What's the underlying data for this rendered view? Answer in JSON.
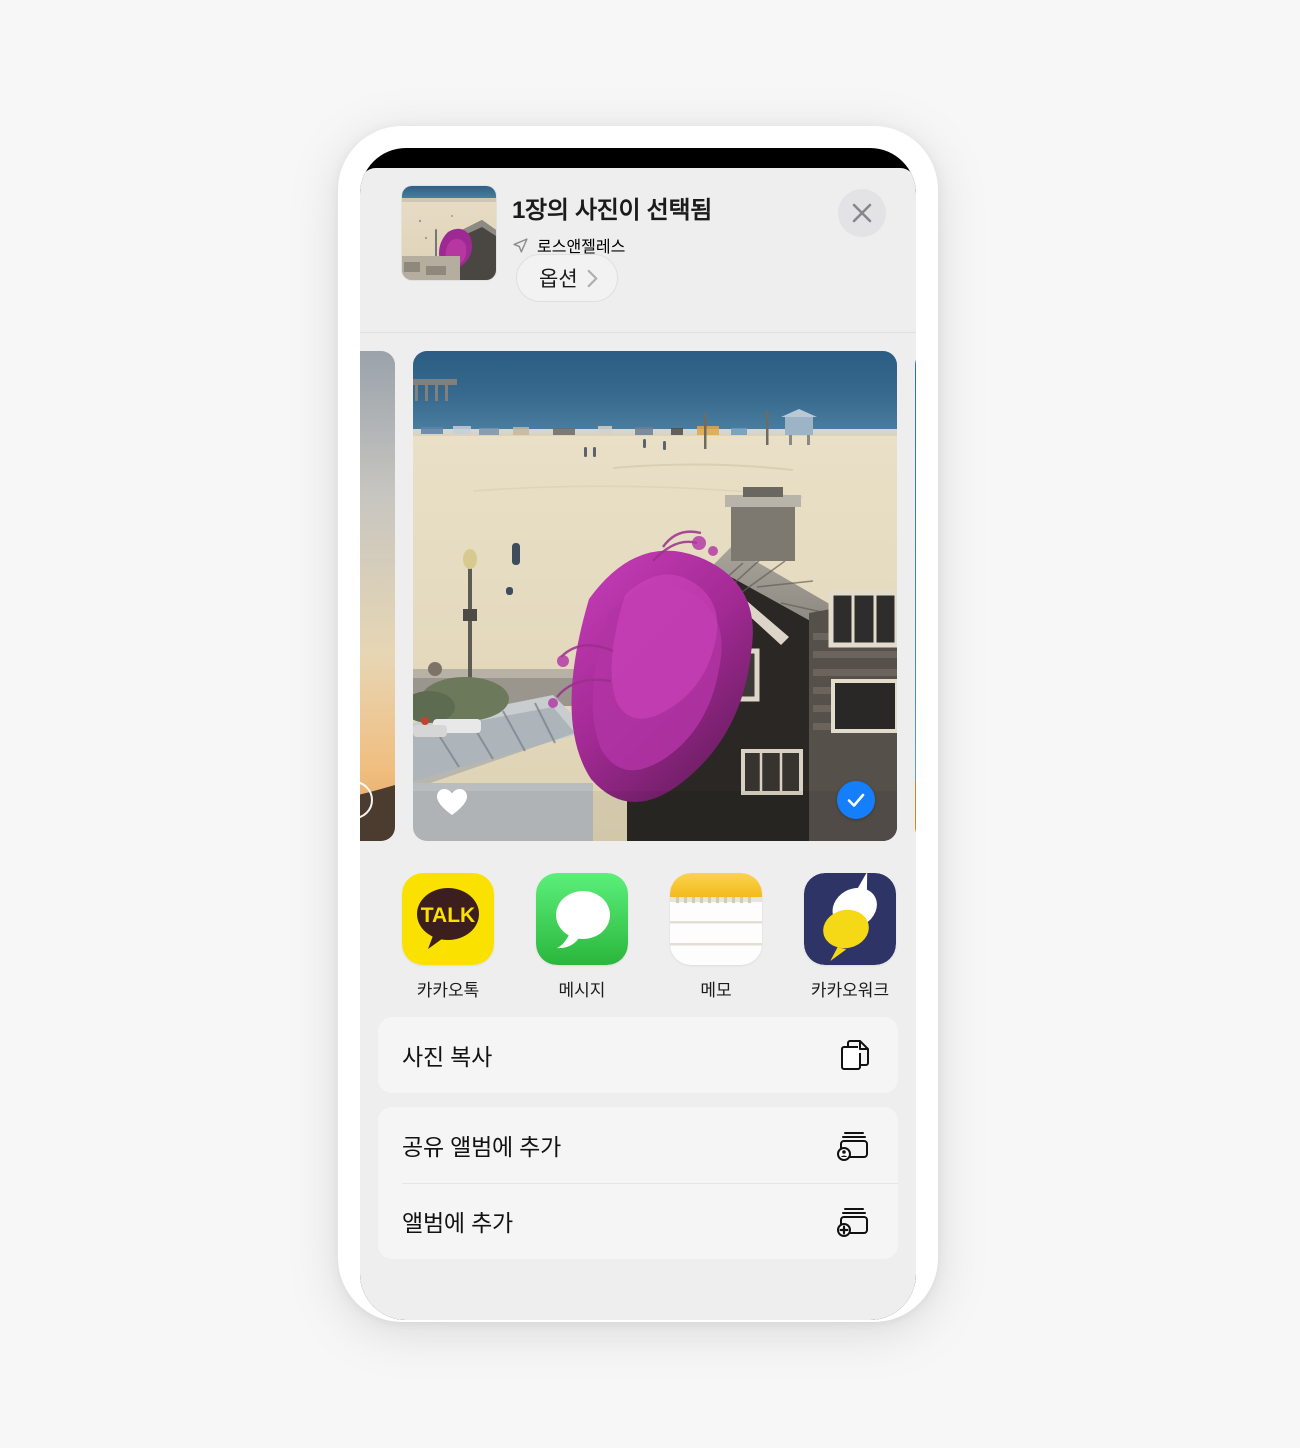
{
  "sheet": {
    "header": {
      "title": "1장의 사진이 선택됨",
      "location": "로스앤젤레스",
      "location_icon": "location-arrow-icon",
      "options_label": "옵션",
      "options_chevron_icon": "chevron-right-icon",
      "close_icon": "close-icon",
      "thumbnail_alt": "beach-house-photo-thumbnail"
    },
    "carousel": {
      "photos": [
        {
          "alt": "sunset-sky-photo",
          "selected": false,
          "favorite": false,
          "badge_icon": "selection-circle-icon"
        },
        {
          "alt": "beach-house-bougainvillea-photo",
          "selected": true,
          "favorite": true,
          "badge_icon": "check-circle-icon",
          "favorite_icon": "heart-icon"
        },
        {
          "alt": "rollercoaster-blue-sky-photo",
          "selected": false,
          "favorite": false,
          "badge_icon": "selection-circle-icon"
        }
      ]
    },
    "apps": [
      {
        "label": "카카오톡",
        "icon": "kakaotalk-icon"
      },
      {
        "label": "메시지",
        "icon": "messages-icon"
      },
      {
        "label": "메모",
        "icon": "notes-icon"
      },
      {
        "label": "카카오워크",
        "icon": "kakaowork-icon"
      },
      {
        "label": "",
        "icon": "more-apps-icon"
      }
    ],
    "action_groups": [
      {
        "rows": [
          {
            "label": "사진 복사",
            "icon": "copy-photo-icon"
          }
        ]
      },
      {
        "rows": [
          {
            "label": "공유 앨범에 추가",
            "icon": "add-to-shared-album-icon"
          },
          {
            "label": "앨범에 추가",
            "icon": "add-to-album-icon"
          }
        ]
      }
    ]
  },
  "colors": {
    "accent_blue": "#147efb",
    "sheet_background": "#eeeeee",
    "row_background": "#f5f5f5",
    "kakao_yellow": "#fae100",
    "messages_green": "#4cd964",
    "notes_yellow": "#f7c843",
    "kakaowork_navy": "#2e3566"
  }
}
